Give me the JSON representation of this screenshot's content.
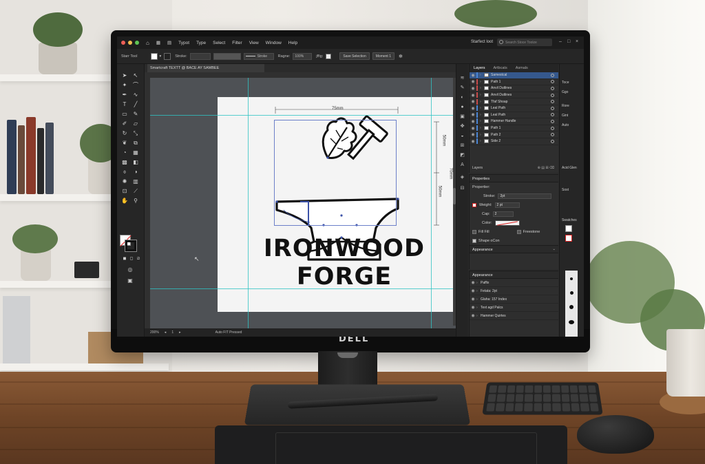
{
  "menubar": {
    "menus": [
      "Typot",
      "Type",
      "Select",
      "Filter",
      "View",
      "Window",
      "Help"
    ],
    "workspace": "Starfect loot",
    "search_placeholder": "Search Stoce Toolze"
  },
  "controlbar": {
    "tool_name": "Starr Tool",
    "stroke_label": "Stroke:",
    "stroke_style": "Stroke",
    "opacity_label": "Ragne:",
    "opacity_value": "100%",
    "style_label": "jffig:",
    "btn_selection": "Save Selection",
    "btn_moment": "Moment 1"
  },
  "document": {
    "tab_title": "Smartcraft TEXTT @ BACE AY SAMBEE",
    "dim_width": "75mm",
    "dim_height1": "50mm",
    "dim_height2": "70mm",
    "dim_height3": "50mm",
    "logo_line1": "IRONWOOD",
    "logo_line2": "FORGE"
  },
  "statusbar": {
    "zoom": "200%",
    "page": "1",
    "status": "Auto FIT Pressed"
  },
  "layers_panel": {
    "tabs": [
      "Layers",
      "Artbcats",
      "Asmals"
    ],
    "rows": [
      {
        "name": "Samestcal",
        "selected": true,
        "color": "#4a86d6"
      },
      {
        "name": "Path 1",
        "selected": false,
        "color": "#c94a4a"
      },
      {
        "name": "Anvil Dutlines",
        "selected": false,
        "color": "#c94a4a"
      },
      {
        "name": "Anvil Dutlines",
        "selected": false,
        "color": "#c94a4a"
      },
      {
        "name": "Tfaf Shoap",
        "selected": false,
        "color": "#c94a4a"
      },
      {
        "name": "Leal Path",
        "selected": false,
        "color": "#4a86d6"
      },
      {
        "name": "Leal Path",
        "selected": false,
        "color": "#4a86d6"
      },
      {
        "name": "Hammer Handle",
        "selected": false,
        "color": "#4a86d6"
      },
      {
        "name": "Path 1",
        "selected": false,
        "color": "#4a86d6"
      },
      {
        "name": "Path 2",
        "selected": false,
        "color": "#4a86d6"
      },
      {
        "name": "Side 2",
        "selected": false,
        "color": "#4a86d6"
      }
    ],
    "footer_label": "Layers"
  },
  "properties_panel": {
    "title": "Properties",
    "subtitle": "Propertier:",
    "stroke_label": "Stroke:",
    "stroke_value": "2pt",
    "weight_label": "Weight:",
    "weight_value": "2 pt",
    "cap_label": "Cap:",
    "cap_value": "2",
    "color_label": "Color:",
    "fill_label": "Fill Fill",
    "freestone_label": "Freestone",
    "shape_label": "Shape oCon",
    "appearance_label": "Appearance"
  },
  "appearance_panel": {
    "title": "Appearance",
    "rows": [
      "Paffix",
      "Fetata: 2pt",
      "Glaha: 157 Index",
      "Text agd Palcs",
      "Hammer Quirtes"
    ]
  },
  "right_strip": {
    "labels": [
      "Toce",
      "Ggo",
      "Rore",
      "Gint",
      "Auto",
      "Acid Glen",
      "Sost",
      "Swatches"
    ]
  },
  "colors": {
    "accent_blue": "#35588c",
    "guide_cyan": "#2fc3c3",
    "selection": "#6b7fc9"
  },
  "monitor": {
    "brand": "DELL"
  }
}
